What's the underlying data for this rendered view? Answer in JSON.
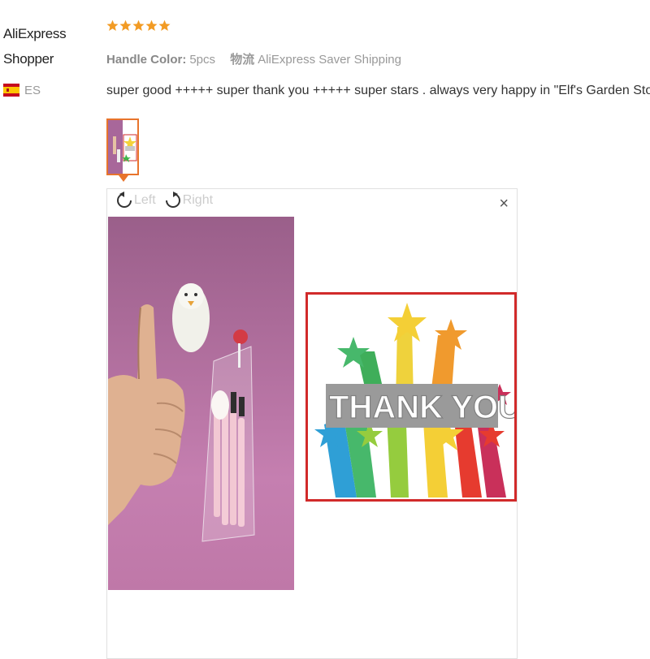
{
  "reviewer": {
    "name_line1": "AliExpress",
    "name_line2": "Shopper",
    "country_code": "ES"
  },
  "rating": {
    "stars": 5,
    "max": 5,
    "color": "#f29b24"
  },
  "attributes": {
    "handle_color_label": "Handle Color:",
    "handle_color_value": "5pcs",
    "shipping_label": "物流",
    "shipping_value": "AliExpress Saver Shipping"
  },
  "review_text": "super good +++++ super thank you +++++ super stars . always very happy in \"Elf's Garden Store\" .",
  "viewer": {
    "rotate_left_label": "Left",
    "rotate_right_label": "Right",
    "close_label": "×",
    "card_text": "THANK YOU!"
  },
  "colors": {
    "accent": "#e8742c",
    "card_border": "#d12a2a"
  }
}
